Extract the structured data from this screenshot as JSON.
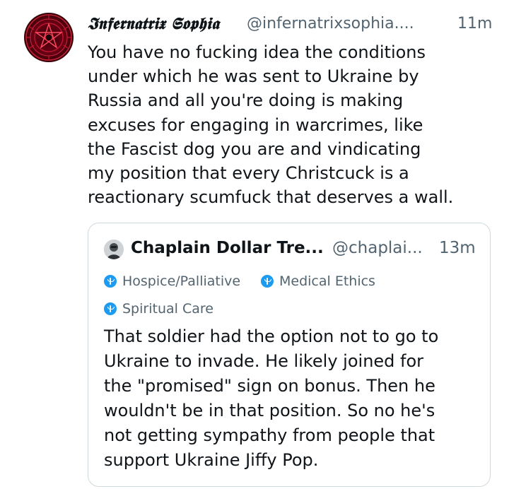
{
  "post": {
    "author": {
      "display_name": "𝕴𝖓𝖋𝖊𝖗𝖓𝖆𝖙𝖗𝖎𝖝 𝕾𝖔𝖕𝖍𝖎𝖆",
      "handle": "@infernatrixsophia....",
      "avatar_icon": "pentagram-sigil-avatar-icon"
    },
    "time": "11m",
    "text_lines": [
      "You have no fucking idea the conditions",
      "under which he was sent to Ukraine by",
      "Russia and all you're doing is making",
      "excuses for engaging in warcrimes, like",
      "the Fascist dog you are and vindicating",
      "my position that every Christcuck is a",
      "reactionary scumfuck that deserves a wall."
    ]
  },
  "quote": {
    "author": {
      "display_name": "Chaplain Dollar Tre...",
      "handle": "@chaplai...",
      "avatar_icon": "person-avatar-icon"
    },
    "time": "13m",
    "badges": [
      {
        "label": "Hospice/Palliative",
        "icon": "medical-badge-icon"
      },
      {
        "label": "Medical Ethics",
        "icon": "medical-badge-icon"
      },
      {
        "label": "Spiritual Care",
        "icon": "medical-badge-icon"
      }
    ],
    "text_lines": [
      "That soldier had the option not to go to",
      "Ukraine to invade. He likely joined for",
      "the \"promised\" sign on bonus. Then he",
      "wouldn't be in that position. So no he's",
      "not getting sympathy from people that",
      "support Ukraine Jiffy Pop."
    ]
  },
  "colors": {
    "text_primary": "#0f1419",
    "text_secondary": "#536471",
    "border": "#cfd9de",
    "badge_blue": "#1d9bf0",
    "avatar_red": "#8a0018"
  }
}
